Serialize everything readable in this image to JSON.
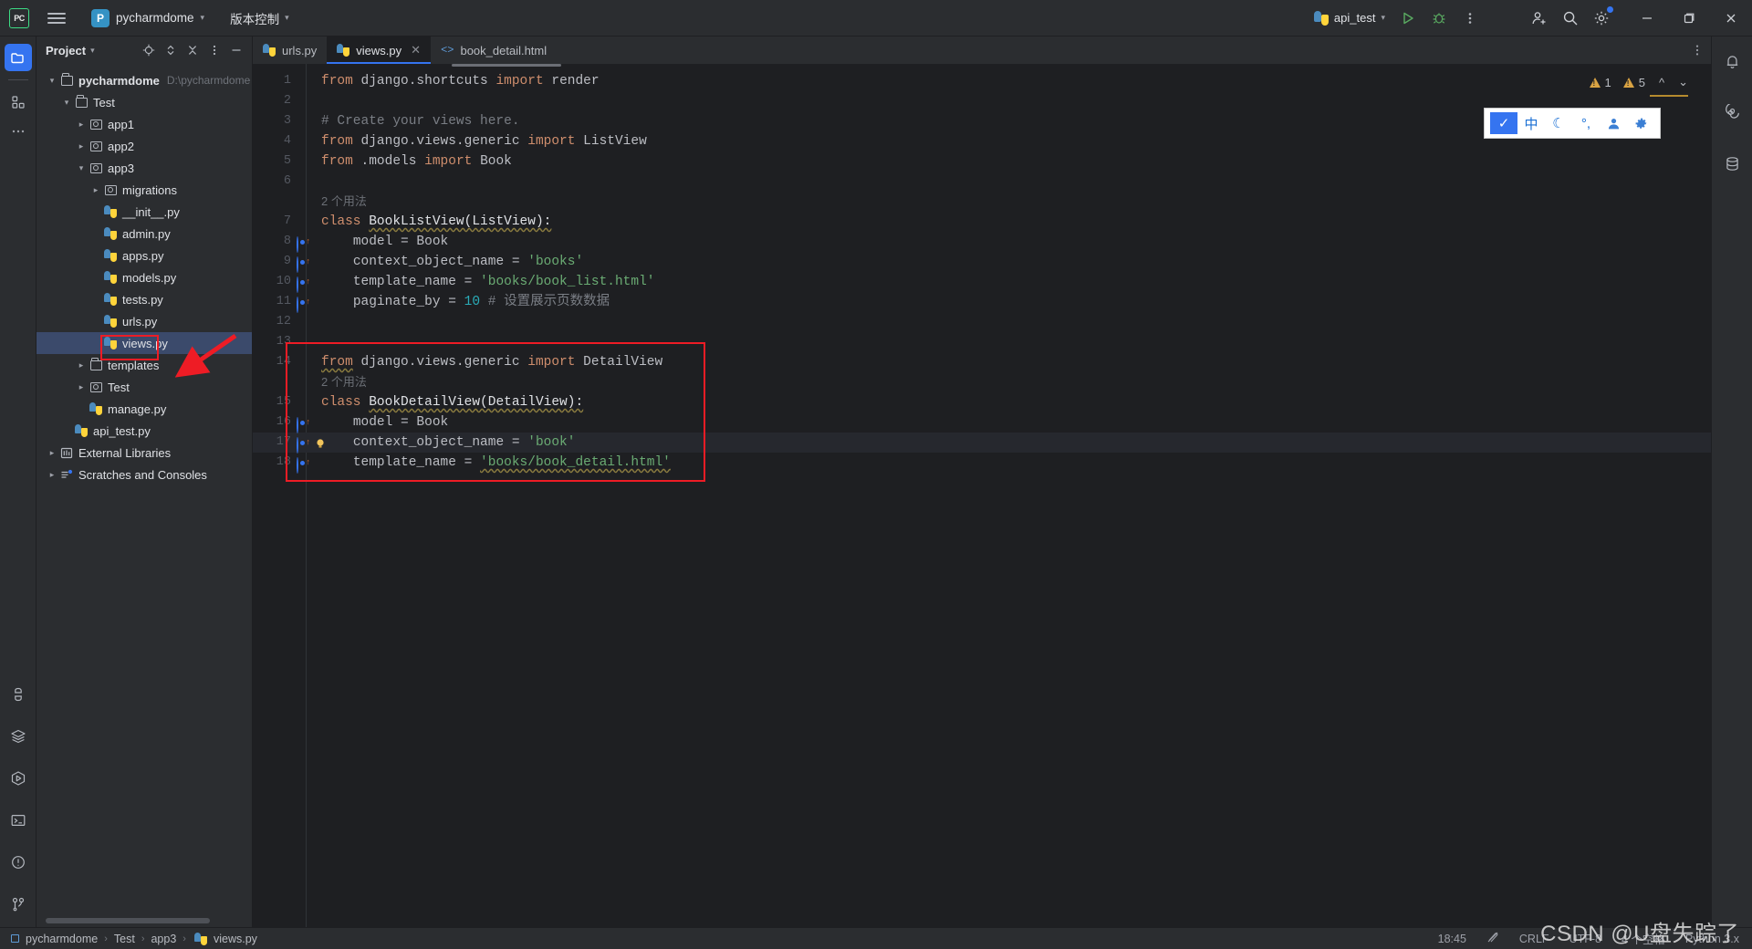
{
  "titlebar": {
    "logo": "pc-logo-icon",
    "menu_icon": "hamburger-menu-icon",
    "project_initial": "P",
    "project_name": "pycharmdome",
    "vcs_label": "版本控制",
    "run_config": "api_test",
    "run_icon": "run-icon",
    "debug_icon": "debug-icon",
    "more_icon": "more-vertical-icon",
    "account_icon": "add-account-icon",
    "search_icon": "search-icon",
    "settings_icon": "gear-icon",
    "minimize": "−",
    "maximize": "maximize-icon",
    "close": "✕"
  },
  "left_rail": {
    "project_icon": "project-folder-icon",
    "structure_icon": "structure-icon",
    "more_icon": "more-horizontal-icon",
    "bottom": [
      {
        "name": "python-console-icon"
      },
      {
        "name": "services-icon"
      },
      {
        "name": "run-panel-icon"
      },
      {
        "name": "terminal-icon"
      },
      {
        "name": "problems-icon"
      },
      {
        "name": "version-control-icon"
      }
    ]
  },
  "project_panel": {
    "title": "Project",
    "actions": [
      "locate-icon",
      "expand-collapse-icon",
      "collapse-all-icon",
      "options-icon",
      "hide-icon"
    ],
    "tree": [
      {
        "depth": 0,
        "arrow": "down",
        "icon": "folder",
        "label": "pycharmdome",
        "bold": true,
        "path": "D:\\pycharmdome",
        "selected": false
      },
      {
        "depth": 1,
        "arrow": "down",
        "icon": "folder",
        "label": "Test",
        "bold": false,
        "path": "",
        "selected": false
      },
      {
        "depth": 2,
        "arrow": "right",
        "icon": "module",
        "label": "app1",
        "bold": false,
        "path": "",
        "selected": false
      },
      {
        "depth": 2,
        "arrow": "right",
        "icon": "module",
        "label": "app2",
        "bold": false,
        "path": "",
        "selected": false
      },
      {
        "depth": 2,
        "arrow": "down",
        "icon": "module",
        "label": "app3",
        "bold": false,
        "path": "",
        "selected": false
      },
      {
        "depth": 3,
        "arrow": "right",
        "icon": "module",
        "label": "migrations",
        "bold": false,
        "path": "",
        "selected": false
      },
      {
        "depth": 3,
        "arrow": "none",
        "icon": "py",
        "label": "__init__.py",
        "bold": false,
        "path": "",
        "selected": false
      },
      {
        "depth": 3,
        "arrow": "none",
        "icon": "py",
        "label": "admin.py",
        "bold": false,
        "path": "",
        "selected": false
      },
      {
        "depth": 3,
        "arrow": "none",
        "icon": "py",
        "label": "apps.py",
        "bold": false,
        "path": "",
        "selected": false
      },
      {
        "depth": 3,
        "arrow": "none",
        "icon": "py",
        "label": "models.py",
        "bold": false,
        "path": "",
        "selected": false
      },
      {
        "depth": 3,
        "arrow": "none",
        "icon": "py",
        "label": "tests.py",
        "bold": false,
        "path": "",
        "selected": false
      },
      {
        "depth": 3,
        "arrow": "none",
        "icon": "py",
        "label": "urls.py",
        "bold": false,
        "path": "",
        "selected": false
      },
      {
        "depth": 3,
        "arrow": "none",
        "icon": "py",
        "label": "views.py",
        "bold": false,
        "path": "",
        "selected": true
      },
      {
        "depth": 2,
        "arrow": "right",
        "icon": "folder",
        "label": "templates",
        "bold": false,
        "path": "",
        "selected": false
      },
      {
        "depth": 2,
        "arrow": "right",
        "icon": "module",
        "label": "Test",
        "bold": false,
        "path": "",
        "selected": false
      },
      {
        "depth": 2,
        "arrow": "none",
        "icon": "py",
        "label": "manage.py",
        "bold": false,
        "path": "",
        "selected": false
      },
      {
        "depth": 1,
        "arrow": "none",
        "icon": "py",
        "label": "api_test.py",
        "bold": false,
        "path": "",
        "selected": false
      },
      {
        "depth": 0,
        "arrow": "right",
        "icon": "library",
        "label": "External Libraries",
        "bold": false,
        "path": "",
        "selected": false
      },
      {
        "depth": 0,
        "arrow": "right",
        "icon": "scratch",
        "label": "Scratches and Consoles",
        "bold": false,
        "path": "",
        "selected": false
      }
    ]
  },
  "editor": {
    "tabs": [
      {
        "label": "urls.py",
        "icon": "python-file-icon",
        "active": false,
        "closable": false
      },
      {
        "label": "views.py",
        "icon": "python-file-icon",
        "active": true,
        "closable": true
      },
      {
        "label": "book_detail.html",
        "icon": "html-file-icon",
        "active": false,
        "closable": false
      }
    ],
    "tab_close_glyph": "✕",
    "more_icon": "more-vertical-icon",
    "lines": [
      {
        "n": "1",
        "gutter": "",
        "text_html": "<span class='kw'>from</span> <span class='plain'>django.shortcuts</span> <span class='kw'>import</span> <span class='plain'>render</span>",
        "plain": "from django.shortcuts import render"
      },
      {
        "n": "2",
        "gutter": "",
        "text_html": "",
        "plain": ""
      },
      {
        "n": "3",
        "gutter": "",
        "text_html": "<span class='cmt'># Create your views here.</span>",
        "plain": "# Create your views here."
      },
      {
        "n": "4",
        "gutter": "",
        "text_html": "<span class='kw'>from</span> <span class='plain'>django.views.generic</span> <span class='kw'>import</span> <span class='plain'>ListView</span>",
        "plain": "from django.views.generic import ListView"
      },
      {
        "n": "5",
        "gutter": "",
        "text_html": "<span class='kw'>from</span> <span class='plain'>.models</span> <span class='kw'>import</span> <span class='plain'>Book</span>",
        "plain": "from .models import Book"
      },
      {
        "n": "6",
        "gutter": "",
        "text_html": "",
        "plain": ""
      },
      {
        "n": "",
        "gutter": "",
        "text_html": "<span class='hint'>2 个用法</span>",
        "plain": "2 个用法"
      },
      {
        "n": "7",
        "gutter": "",
        "text_html": "<span class='kw'>class</span> <span class='cls wavy'>BookListView(ListView):</span>",
        "plain": "class BookListView(ListView):"
      },
      {
        "n": "8",
        "gutter": "override",
        "text_html": "    <span class='plain'>model = Book</span>",
        "plain": "    model = Book"
      },
      {
        "n": "9",
        "gutter": "override",
        "text_html": "    <span class='plain'>context_object_name = </span><span class='str'>'books'</span>",
        "plain": "    context_object_name = 'books'"
      },
      {
        "n": "10",
        "gutter": "override",
        "text_html": "    <span class='plain'>template_name = </span><span class='str'>'books/book_list.html'</span>",
        "plain": "    template_name = 'books/book_list.html'"
      },
      {
        "n": "11",
        "gutter": "override",
        "text_html": "    <span class='plain'>paginate_by = </span><span class='num'>10</span> <span class='cmt'># 设置展示页数数据</span>",
        "plain": "    paginate_by = 10 # 设置展示页数数据"
      },
      {
        "n": "12",
        "gutter": "",
        "text_html": "",
        "plain": ""
      },
      {
        "n": "13",
        "gutter": "",
        "text_html": "",
        "plain": ""
      },
      {
        "n": "14",
        "gutter": "",
        "text_html": "<span class='kw wavy'>from</span> <span class='plain'>django.views.generic</span> <span class='kw'>import</span> <span class='plain'>DetailView</span>",
        "plain": "from django.views.generic import DetailView"
      },
      {
        "n": "",
        "gutter": "",
        "text_html": "<span class='hint'>2 个用法</span>",
        "plain": "2 个用法"
      },
      {
        "n": "15",
        "gutter": "",
        "text_html": "<span class='kw'>class</span> <span class='cls wavy'>BookDetailView(DetailView):</span>",
        "plain": "class BookDetailView(DetailView):"
      },
      {
        "n": "16",
        "gutter": "override",
        "text_html": "    <span class='plain'>model = Book</span>",
        "plain": "    model = Book"
      },
      {
        "n": "17",
        "gutter": "override-bulb",
        "text_html": "    <span class='plain'>context_object_name = </span><span class='str'>'book'</span>",
        "plain": "    context_object_name = 'book'"
      },
      {
        "n": "18",
        "gutter": "override",
        "text_html": "    <span class='plain'>template_name = </span><span class='str wavy'>'books/book_detail.html'</span>",
        "plain": "    template_name = 'books/book_detail.html'"
      }
    ],
    "inspection": {
      "warning_count": "1",
      "weak_warning_count": "5",
      "up_arrow": "^",
      "down_arrow": "⌄"
    },
    "float_toolbar": [
      {
        "name": "ime-checkbox-icon",
        "glyph": "✓",
        "selected": true
      },
      {
        "name": "ime-chinese-icon",
        "glyph": "中",
        "selected": false
      },
      {
        "name": "ime-moon-icon",
        "glyph": "☾",
        "selected": false
      },
      {
        "name": "ime-punctuation-icon",
        "glyph": "°,",
        "selected": false
      },
      {
        "name": "ime-user-icon",
        "glyph": "person",
        "selected": false
      },
      {
        "name": "ime-settings-icon",
        "glyph": "gear",
        "selected": false
      }
    ]
  },
  "right_rail": [
    {
      "name": "notifications-bell-icon"
    },
    {
      "name": "ai-assistant-icon"
    },
    {
      "name": "database-icon"
    }
  ],
  "statusbar": {
    "breadcrumbs": [
      "pycharmdome",
      "Test",
      "app3",
      "views.py"
    ],
    "separator": "›",
    "time": "18:45",
    "lock_icon": "no-edit-icon",
    "line_sep": "CRLF",
    "encoding": "UTF-8",
    "indent": "4 个空格",
    "interpreter": "Python 3.x",
    "watermark": "CSDN @U盘失踪了"
  },
  "colors": {
    "accent": "#3574f0",
    "bg": "#2b2d30",
    "editor_bg": "#1e1f22",
    "annotation_red": "#ee1c25",
    "warning": "#d9a343",
    "string_green": "#6aab73",
    "keyword_orange": "#cf8e6d"
  }
}
